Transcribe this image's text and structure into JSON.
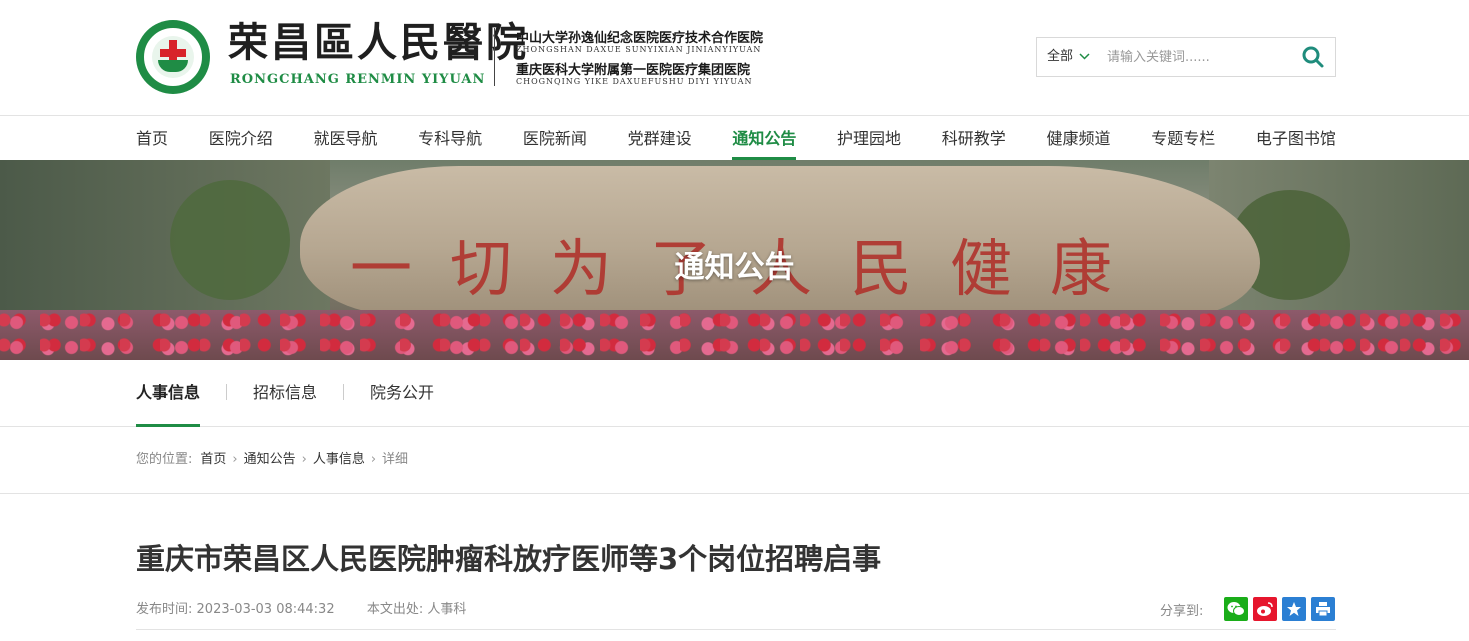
{
  "header": {
    "hospital_name_cn": "荣昌區人民醫院",
    "hospital_name_en": "RONGCHANG RENMIN YIYUAN",
    "partner_1_cn": "中山大学孙逸仙纪念医院医疗技术合作医院",
    "partner_1_en": "ZHONGSHAN DAXUE SUNYIXIAN JINIANYIYUAN",
    "partner_2_cn": "重庆医科大学附属第一医院医疗集团医院",
    "partner_2_en": "CHOGNQING YIKE DAXUEFUSHU DIYI YIYUAN",
    "brand_color": "#1f8c45"
  },
  "search": {
    "scope": "全部",
    "placeholder": "请输入关键词......",
    "value": "",
    "icon": "search-icon"
  },
  "nav": {
    "items": [
      {
        "label": "首页"
      },
      {
        "label": "医院介绍"
      },
      {
        "label": "就医导航"
      },
      {
        "label": "专科导航"
      },
      {
        "label": "医院新闻"
      },
      {
        "label": "党群建设"
      },
      {
        "label": "通知公告",
        "active": true
      },
      {
        "label": "护理园地"
      },
      {
        "label": "科研教学"
      },
      {
        "label": "健康频道"
      },
      {
        "label": "专题专栏"
      },
      {
        "label": "电子图书馆"
      }
    ]
  },
  "banner": {
    "title": "通知公告"
  },
  "subnav": {
    "items": [
      {
        "label": "人事信息",
        "active": true
      },
      {
        "label": "招标信息"
      },
      {
        "label": "院务公开"
      }
    ]
  },
  "breadcrumb": {
    "label": "您的位置:",
    "items": [
      "首页",
      "通知公告",
      "人事信息",
      "详细"
    ]
  },
  "article": {
    "title": "重庆市荣昌区人民医院肿瘤科放疗医师等3个岗位招聘启事",
    "publish_label": "发布时间:",
    "publish_time": "2023-03-03 08:44:32",
    "source_label": "本文出处:",
    "source": "人事科",
    "share_label": "分享到:",
    "share_icons": [
      "wechat-icon",
      "weibo-icon",
      "favorite-icon",
      "print-icon"
    ],
    "share_colors": [
      "#1aad19",
      "#e6162d",
      "#2b7fd3",
      "#2b7fd3"
    ]
  }
}
